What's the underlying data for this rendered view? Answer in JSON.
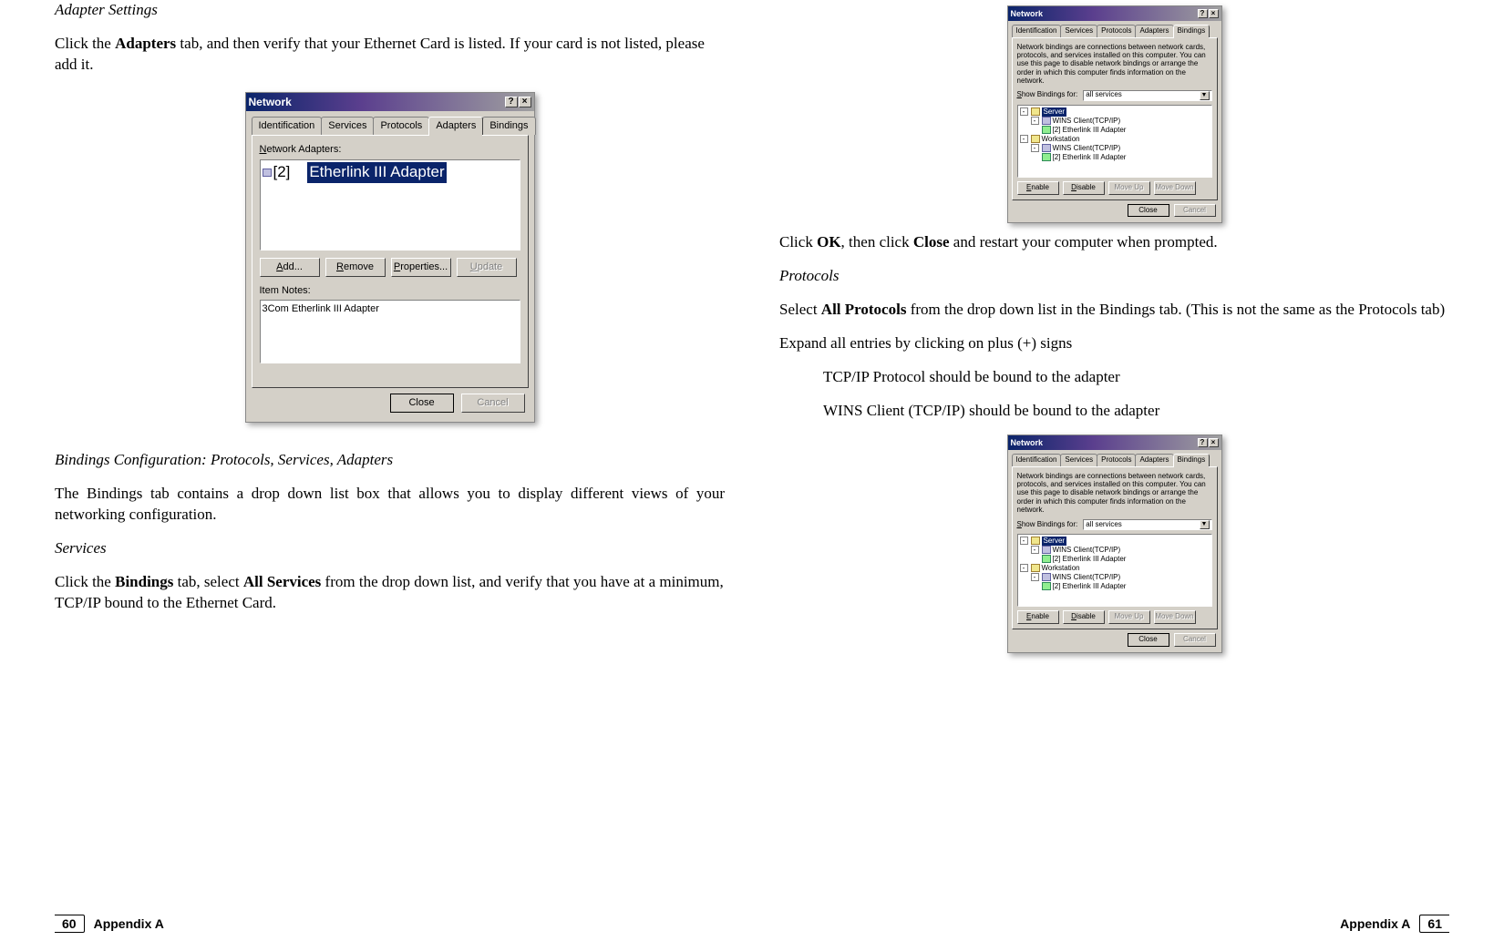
{
  "left": {
    "heading_adapter": "Adapter Settings",
    "adapter_p1_a": "Click the ",
    "adapter_p1_bold": "Adapters",
    "adapter_p1_b": " tab, and then verify that your Ethernet Card is listed. If your card is not listed, please add it.",
    "heading_bindings": "Bindings Configuration: Protocols, Services, Adapters",
    "bindings_p1": "The Bindings tab contains a drop down list box that allows you to display different views of your networking configuration.",
    "heading_services": "Services",
    "services_p1_a": "Click the ",
    "services_p1_b1": "Bindings",
    "services_p1_c": " tab, select ",
    "services_p1_b2": "All Services",
    "services_p1_d": " from the drop down list, and verify that you have at a minimum, TCP/IP bound to the Ethernet Card."
  },
  "right": {
    "p1_a": "Click ",
    "p1_b1": "OK",
    "p1_c": ", then click ",
    "p1_b2": "Close",
    "p1_d": " and restart your computer when prompted.",
    "heading_protocols": "Protocols",
    "proto_p1_a": "Select ",
    "proto_p1_b": "All Protocols",
    "proto_p1_c": " from the drop down list in the Bindings tab. (This is not the same as the Protocols tab)",
    "proto_p2": "Expand all entries by clicking on plus (+) signs",
    "proto_ind1": "TCP/IP Protocol should be bound to the adapter",
    "proto_ind2": "WINS Client (TCP/IP) should be bound to the adapter"
  },
  "dialog_adapters": {
    "title": "Network",
    "tabs": [
      "Identification",
      "Services",
      "Protocols",
      "Adapters",
      "Bindings"
    ],
    "active_tab_index": 3,
    "label_adapters": "Network Adapters:",
    "list_prefix": "[2]",
    "list_item": "Etherlink III Adapter",
    "btn_add": "Add...",
    "btn_remove": "Remove",
    "btn_properties": "Properties...",
    "btn_update": "Update",
    "label_notes": "Item Notes:",
    "notes_text": "3Com Etherlink III Adapter",
    "btn_close": "Close",
    "btn_cancel": "Cancel",
    "help_glyph": "?",
    "close_glyph": "×"
  },
  "dialog_bindings": {
    "title": "Network",
    "tabs": [
      "Identification",
      "Services",
      "Protocols",
      "Adapters",
      "Bindings"
    ],
    "active_tab_index": 4,
    "desc": "Network bindings are connections between network cards, protocols, and services installed on this computer. You can use this page to disable network bindings or arrange the order in which this computer finds information on the network.",
    "label_show": "Show Bindings for:",
    "combo_value": "all services",
    "tree": {
      "server": "Server",
      "wins1": "WINS Client(TCP/IP)",
      "adapter1": "[2] Etherlink III Adapter",
      "workstation": "Workstation",
      "wins2": "WINS Client(TCP/IP)",
      "adapter2": "[2] Etherlink III Adapter"
    },
    "btn_enable": "Enable",
    "btn_disable": "Disable",
    "btn_moveup": "Move Up",
    "btn_movedown": "Move Down",
    "btn_close": "Close",
    "btn_cancel": "Cancel",
    "help_glyph": "?",
    "close_glyph": "×"
  },
  "footer": {
    "left_num": "60",
    "left_label": "Appendix A",
    "right_label": "Appendix A",
    "right_num": "61"
  }
}
